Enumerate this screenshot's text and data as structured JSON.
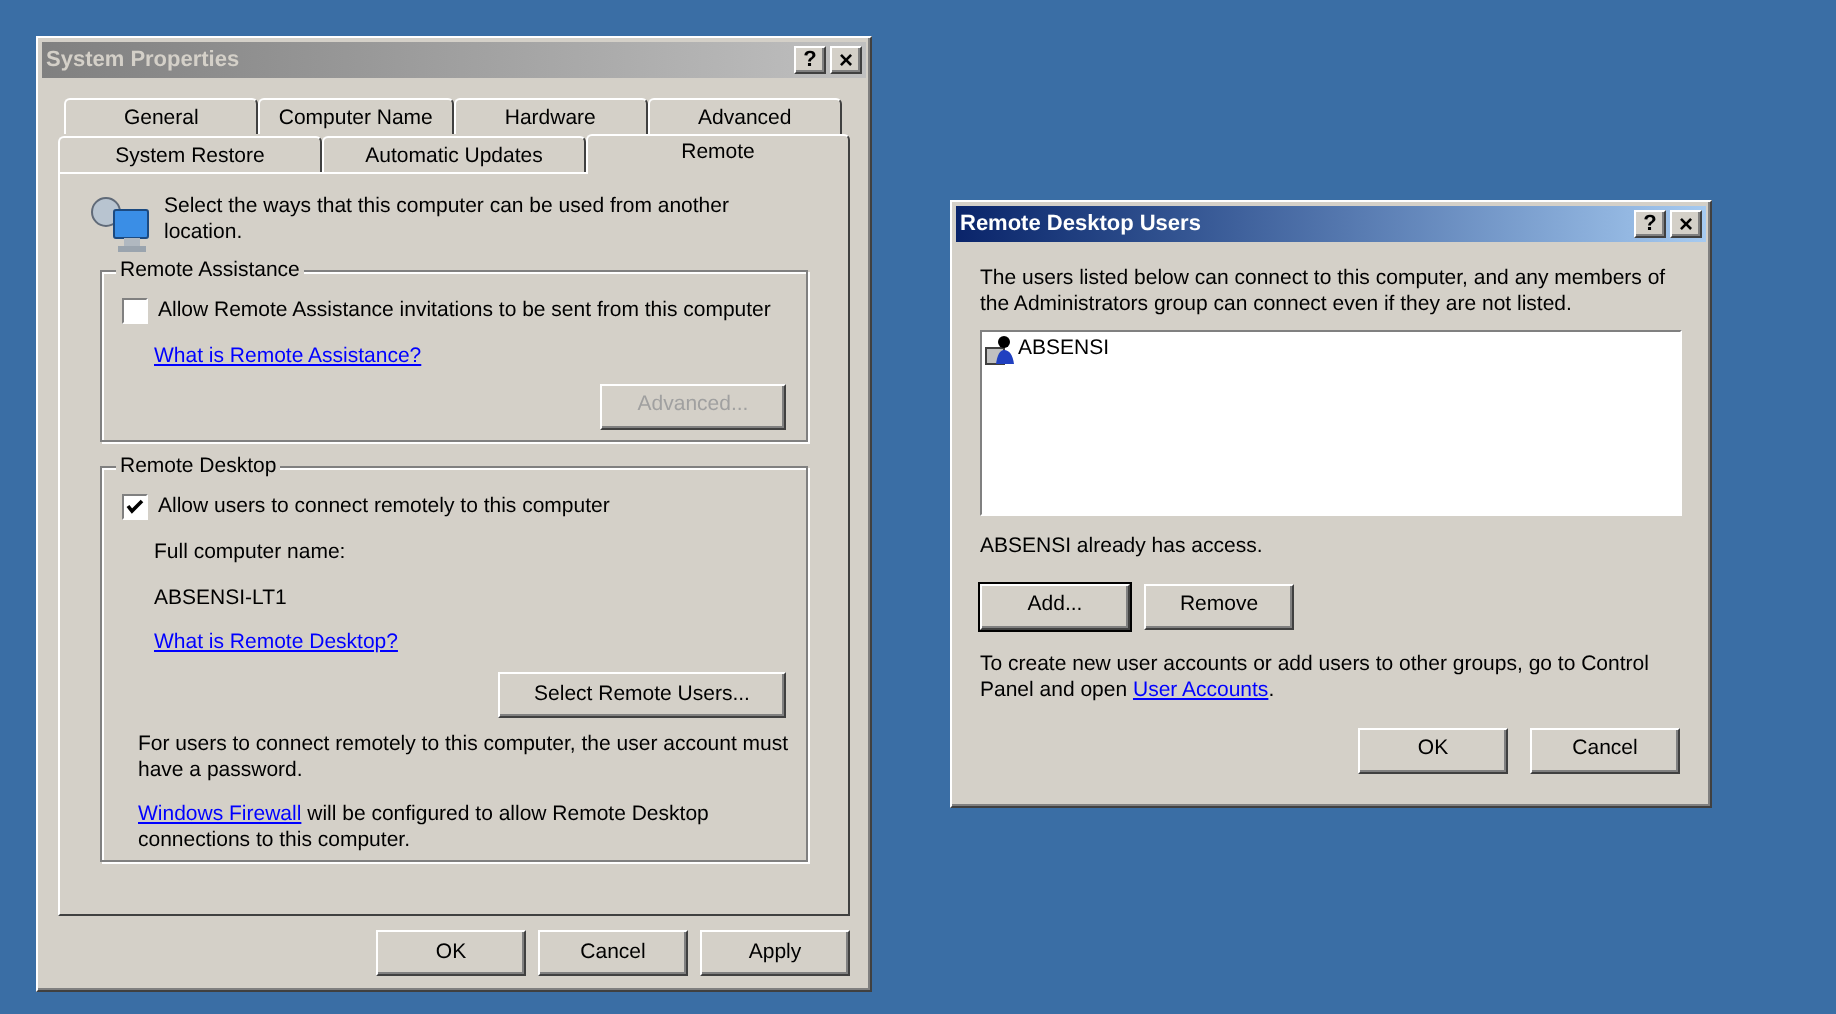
{
  "system_properties": {
    "title": "System Properties",
    "active": false,
    "help_button": "?",
    "close_button": "×",
    "tab_rows": [
      [
        {
          "label": "General",
          "selected": false
        },
        {
          "label": "Computer Name",
          "selected": false
        },
        {
          "label": "Hardware",
          "selected": false
        },
        {
          "label": "Advanced",
          "selected": false
        }
      ],
      [
        {
          "label": "System Restore",
          "selected": false
        },
        {
          "label": "Automatic Updates",
          "selected": false
        },
        {
          "label": "Remote",
          "selected": true
        }
      ]
    ],
    "intro": "Select the ways that this computer can be used from another location.",
    "remote_assistance": {
      "title": "Remote Assistance",
      "checkbox": {
        "label": "Allow Remote Assistance invitations to be sent from this computer",
        "checked": false
      },
      "link": "What is Remote Assistance?",
      "button": {
        "label": "Advanced...",
        "disabled": true
      }
    },
    "remote_desktop": {
      "title": "Remote Desktop",
      "checkbox": {
        "label": "Allow users to connect remotely to this computer",
        "checked": true
      },
      "name_label": "Full computer name:",
      "computer_name": "ABSENSI-LT1",
      "link": "What is Remote Desktop?",
      "button": {
        "label": "Select Remote Users...",
        "disabled": false
      },
      "note": "For users to connect remotely to this computer, the user account must have a password.",
      "firewall_note": {
        "link": "Windows Firewall",
        "text": " will be configured to allow Remote Desktop connections to this computer."
      }
    },
    "buttons": [
      "OK",
      "Cancel",
      "Apply"
    ]
  },
  "remote_desktop_users": {
    "title": "Remote Desktop Users",
    "active": true,
    "help_button": "?",
    "close_button": "×",
    "description": "The users listed below can connect to this computer, and any members of the Administrators group can connect even if they are not listed.",
    "users": [
      "ABSENSI"
    ],
    "status": "ABSENSI already has access.",
    "actions": [
      {
        "label": "Add...",
        "default": true
      },
      {
        "label": "Remove",
        "default": false
      }
    ],
    "footer": {
      "text": "To create new user accounts or add users to other groups, go to Control Panel and open ",
      "link": "User Accounts",
      "after": "."
    },
    "buttons": [
      "OK",
      "Cancel"
    ]
  }
}
